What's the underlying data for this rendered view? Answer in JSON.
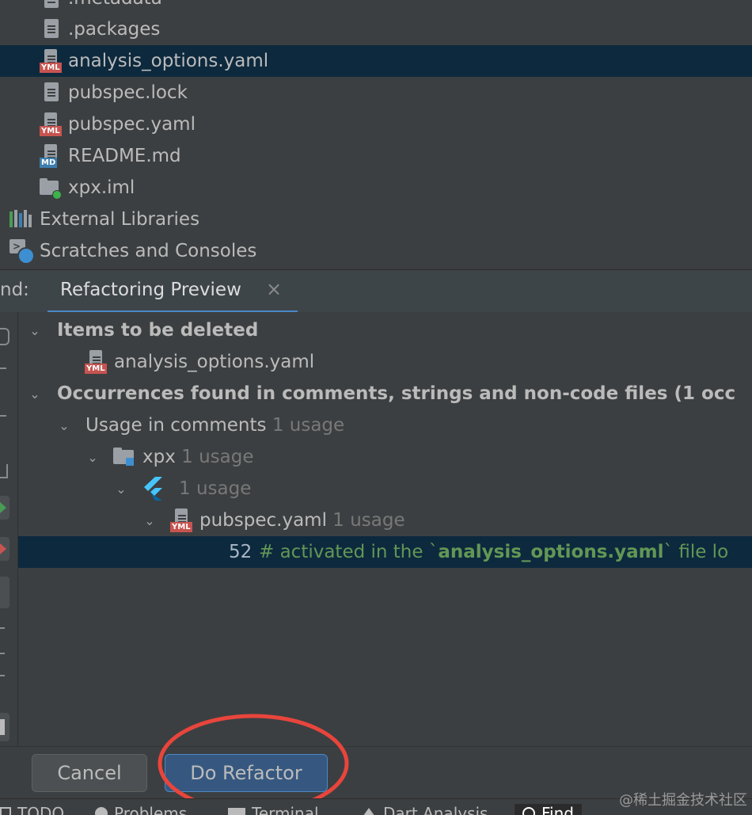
{
  "project_tree": {
    "items": [
      {
        "label": ".metadata",
        "icon": "file-icon"
      },
      {
        "label": ".packages",
        "icon": "file-icon"
      },
      {
        "label": "analysis_options.yaml",
        "icon": "yaml-file-icon",
        "badge": "YML"
      },
      {
        "label": "pubspec.lock",
        "icon": "file-icon"
      },
      {
        "label": "pubspec.yaml",
        "icon": "yaml-file-icon",
        "badge": "YML"
      },
      {
        "label": "README.md",
        "icon": "markdown-file-icon",
        "badge": "MD"
      },
      {
        "label": "xpx.iml",
        "icon": "module-file-icon"
      },
      {
        "label": "External Libraries",
        "icon": "libraries-icon"
      },
      {
        "label": "Scratches and Consoles",
        "icon": "scratches-icon"
      }
    ]
  },
  "find_panel": {
    "prefix": "nd:",
    "tab_label": "Refactoring Preview"
  },
  "tree": {
    "items_to_delete": "Items to be deleted",
    "deleted_file": "analysis_options.yaml",
    "occurrences": "Occurrences found in comments, strings and non-code files",
    "occurrences_count": "(1 occ",
    "usage_in_comments": "Usage in comments",
    "usage_in_comments_count": "1 usage",
    "xpx": "xpx",
    "xpx_count": "1 usage",
    "flutter_count": "1 usage",
    "pubspec": "pubspec.yaml",
    "pubspec_count": "1 usage",
    "line_number": "52",
    "code_before": "# activated in the `",
    "code_highlight": "analysis_options.yaml",
    "code_after": "` file lo"
  },
  "buttons": {
    "cancel": "Cancel",
    "do_refactor": "Do Refactor"
  },
  "status_bar": {
    "todo": "TODO",
    "problems": "Problems",
    "terminal": "Terminal",
    "dart_analysis": "Dart Analysis",
    "find": "Find"
  },
  "watermark": "@稀土掘金技术社区",
  "colors": {
    "background": "#3c3f41",
    "selection": "#0d293e",
    "comment_green": "#629755",
    "annotation_circle": "#e8453c",
    "primary_button": "#365880"
  }
}
